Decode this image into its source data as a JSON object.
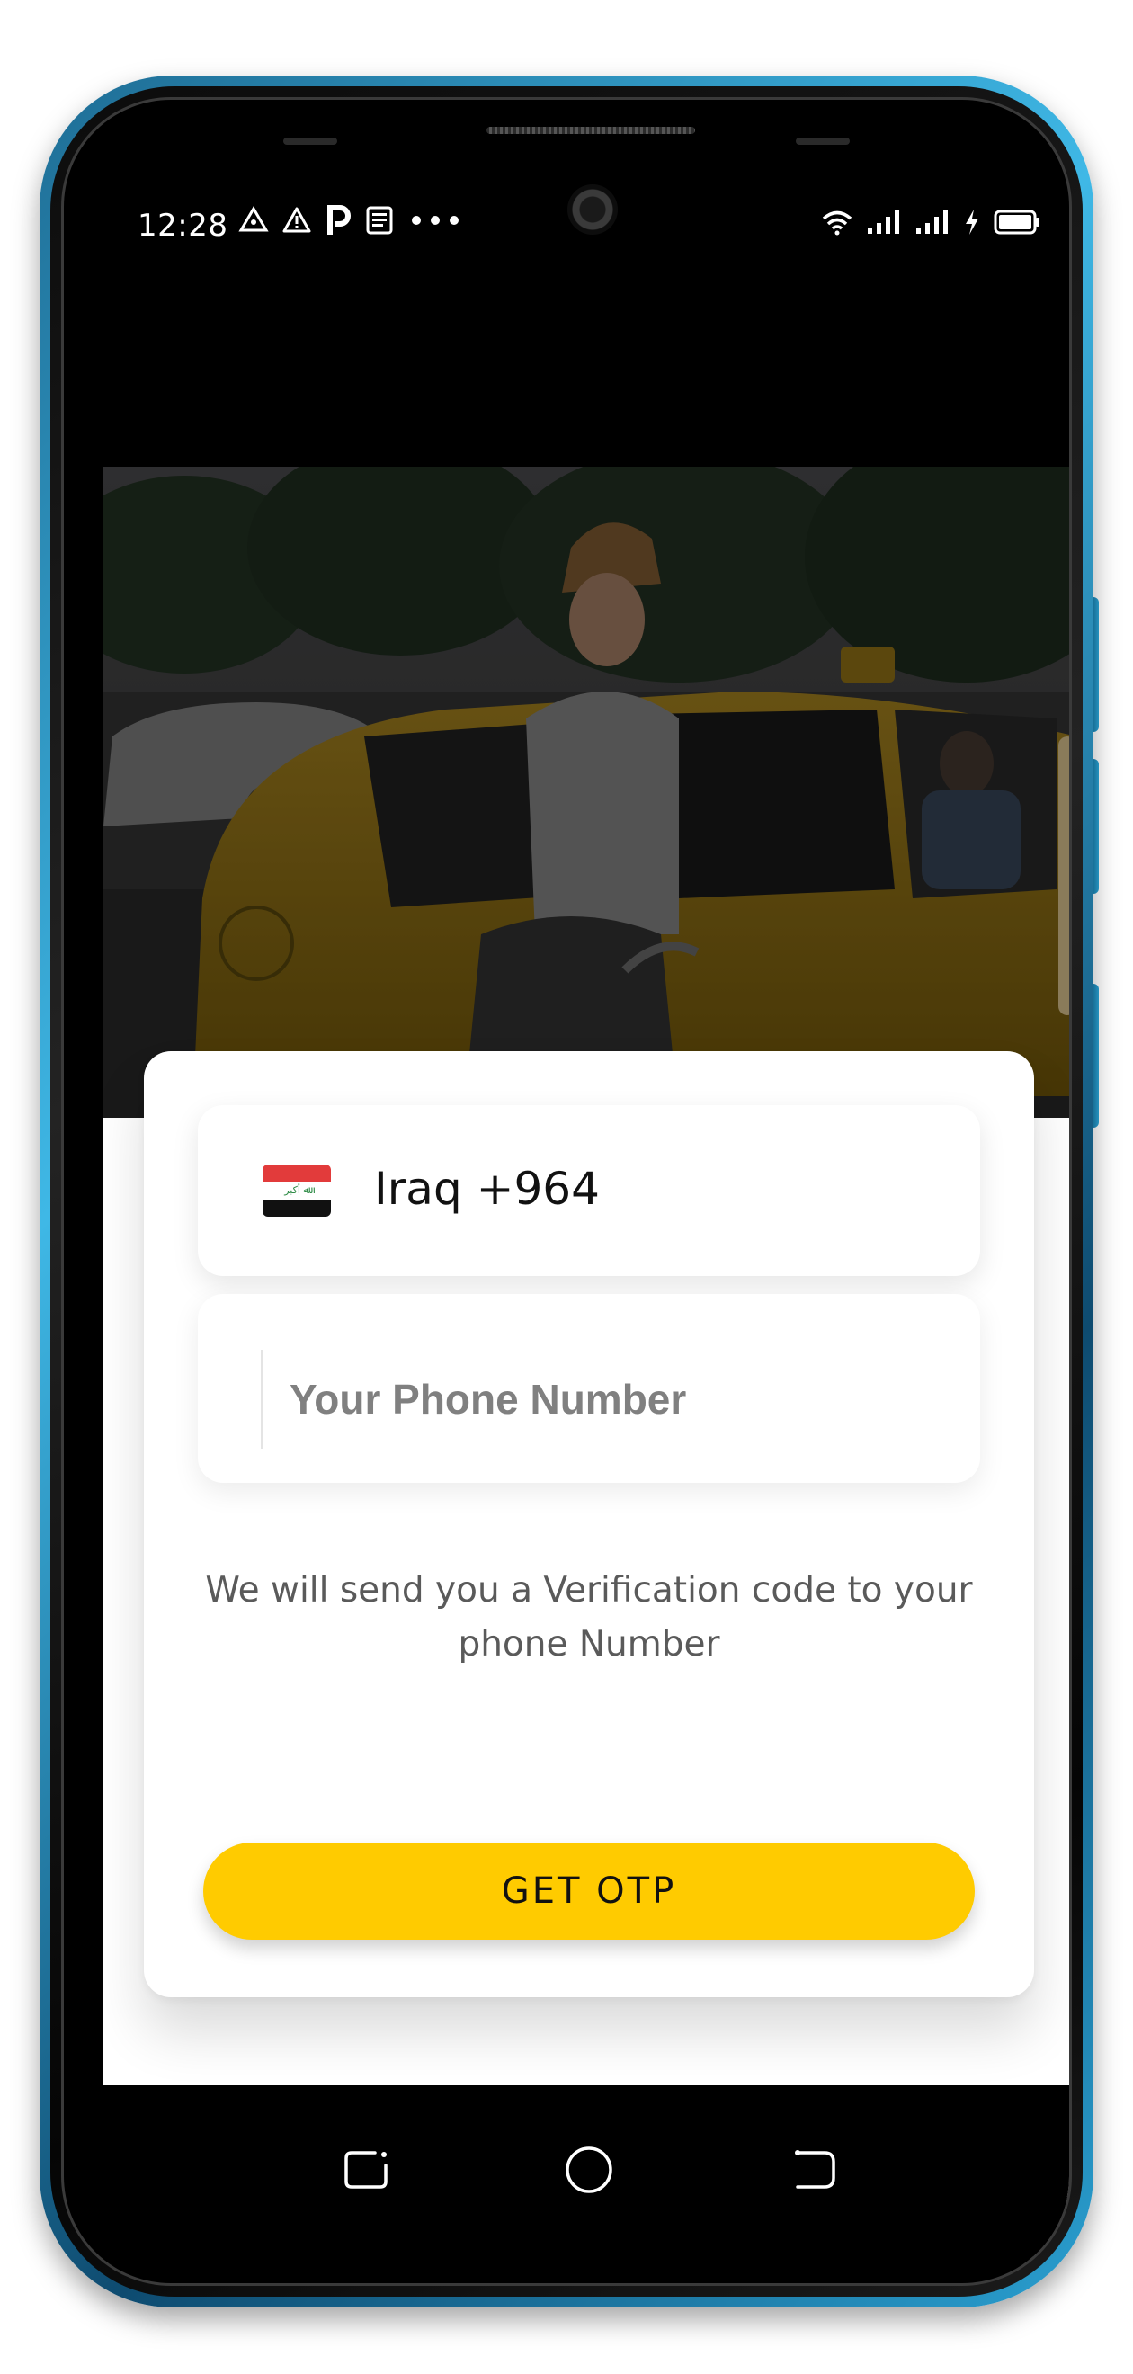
{
  "status_bar": {
    "time": "12:28",
    "left_icons": [
      "delta-icon",
      "warning-icon",
      "parking-icon",
      "news-icon",
      "more-dots-icon"
    ],
    "right_icons": [
      "wifi-icon",
      "signal-icon",
      "signal-icon",
      "charging-icon",
      "battery-icon"
    ]
  },
  "hero": {
    "image": "woman-entering-yellow-taxi"
  },
  "country_selector": {
    "flag": "iraq-flag-icon",
    "label": "Iraq +964"
  },
  "phone_input": {
    "value": "",
    "placeholder": "Your Phone Number"
  },
  "info_text": "We will send you a Verification code to your phone Number",
  "otp_button": {
    "label": "GET OTP"
  },
  "nav_bar": {
    "buttons": [
      "recent-apps-icon",
      "home-icon",
      "back-icon"
    ]
  },
  "colors": {
    "accent": "#ffcb00",
    "card_bg": "#ffffff",
    "text_primary": "#111111",
    "text_secondary": "#5a5a5a",
    "placeholder": "#808080",
    "blue_edge": "#2f6bdc",
    "frame": "#2ca6d8"
  }
}
